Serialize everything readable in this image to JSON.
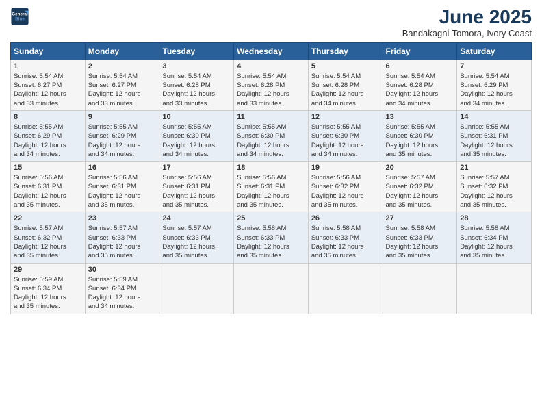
{
  "logo": {
    "line1": "General",
    "line2": "Blue"
  },
  "title": "June 2025",
  "subtitle": "Bandakagni-Tomora, Ivory Coast",
  "days_of_week": [
    "Sunday",
    "Monday",
    "Tuesday",
    "Wednesday",
    "Thursday",
    "Friday",
    "Saturday"
  ],
  "weeks": [
    [
      {
        "day": "1",
        "info": "Sunrise: 5:54 AM\nSunset: 6:27 PM\nDaylight: 12 hours\nand 33 minutes."
      },
      {
        "day": "2",
        "info": "Sunrise: 5:54 AM\nSunset: 6:27 PM\nDaylight: 12 hours\nand 33 minutes."
      },
      {
        "day": "3",
        "info": "Sunrise: 5:54 AM\nSunset: 6:28 PM\nDaylight: 12 hours\nand 33 minutes."
      },
      {
        "day": "4",
        "info": "Sunrise: 5:54 AM\nSunset: 6:28 PM\nDaylight: 12 hours\nand 33 minutes."
      },
      {
        "day": "5",
        "info": "Sunrise: 5:54 AM\nSunset: 6:28 PM\nDaylight: 12 hours\nand 34 minutes."
      },
      {
        "day": "6",
        "info": "Sunrise: 5:54 AM\nSunset: 6:28 PM\nDaylight: 12 hours\nand 34 minutes."
      },
      {
        "day": "7",
        "info": "Sunrise: 5:54 AM\nSunset: 6:29 PM\nDaylight: 12 hours\nand 34 minutes."
      }
    ],
    [
      {
        "day": "8",
        "info": "Sunrise: 5:55 AM\nSunset: 6:29 PM\nDaylight: 12 hours\nand 34 minutes."
      },
      {
        "day": "9",
        "info": "Sunrise: 5:55 AM\nSunset: 6:29 PM\nDaylight: 12 hours\nand 34 minutes."
      },
      {
        "day": "10",
        "info": "Sunrise: 5:55 AM\nSunset: 6:30 PM\nDaylight: 12 hours\nand 34 minutes."
      },
      {
        "day": "11",
        "info": "Sunrise: 5:55 AM\nSunset: 6:30 PM\nDaylight: 12 hours\nand 34 minutes."
      },
      {
        "day": "12",
        "info": "Sunrise: 5:55 AM\nSunset: 6:30 PM\nDaylight: 12 hours\nand 34 minutes."
      },
      {
        "day": "13",
        "info": "Sunrise: 5:55 AM\nSunset: 6:30 PM\nDaylight: 12 hours\nand 35 minutes."
      },
      {
        "day": "14",
        "info": "Sunrise: 5:55 AM\nSunset: 6:31 PM\nDaylight: 12 hours\nand 35 minutes."
      }
    ],
    [
      {
        "day": "15",
        "info": "Sunrise: 5:56 AM\nSunset: 6:31 PM\nDaylight: 12 hours\nand 35 minutes."
      },
      {
        "day": "16",
        "info": "Sunrise: 5:56 AM\nSunset: 6:31 PM\nDaylight: 12 hours\nand 35 minutes."
      },
      {
        "day": "17",
        "info": "Sunrise: 5:56 AM\nSunset: 6:31 PM\nDaylight: 12 hours\nand 35 minutes."
      },
      {
        "day": "18",
        "info": "Sunrise: 5:56 AM\nSunset: 6:31 PM\nDaylight: 12 hours\nand 35 minutes."
      },
      {
        "day": "19",
        "info": "Sunrise: 5:56 AM\nSunset: 6:32 PM\nDaylight: 12 hours\nand 35 minutes."
      },
      {
        "day": "20",
        "info": "Sunrise: 5:57 AM\nSunset: 6:32 PM\nDaylight: 12 hours\nand 35 minutes."
      },
      {
        "day": "21",
        "info": "Sunrise: 5:57 AM\nSunset: 6:32 PM\nDaylight: 12 hours\nand 35 minutes."
      }
    ],
    [
      {
        "day": "22",
        "info": "Sunrise: 5:57 AM\nSunset: 6:32 PM\nDaylight: 12 hours\nand 35 minutes."
      },
      {
        "day": "23",
        "info": "Sunrise: 5:57 AM\nSunset: 6:33 PM\nDaylight: 12 hours\nand 35 minutes."
      },
      {
        "day": "24",
        "info": "Sunrise: 5:57 AM\nSunset: 6:33 PM\nDaylight: 12 hours\nand 35 minutes."
      },
      {
        "day": "25",
        "info": "Sunrise: 5:58 AM\nSunset: 6:33 PM\nDaylight: 12 hours\nand 35 minutes."
      },
      {
        "day": "26",
        "info": "Sunrise: 5:58 AM\nSunset: 6:33 PM\nDaylight: 12 hours\nand 35 minutes."
      },
      {
        "day": "27",
        "info": "Sunrise: 5:58 AM\nSunset: 6:33 PM\nDaylight: 12 hours\nand 35 minutes."
      },
      {
        "day": "28",
        "info": "Sunrise: 5:58 AM\nSunset: 6:34 PM\nDaylight: 12 hours\nand 35 minutes."
      }
    ],
    [
      {
        "day": "29",
        "info": "Sunrise: 5:59 AM\nSunset: 6:34 PM\nDaylight: 12 hours\nand 35 minutes."
      },
      {
        "day": "30",
        "info": "Sunrise: 5:59 AM\nSunset: 6:34 PM\nDaylight: 12 hours\nand 34 minutes."
      },
      {
        "day": "",
        "info": ""
      },
      {
        "day": "",
        "info": ""
      },
      {
        "day": "",
        "info": ""
      },
      {
        "day": "",
        "info": ""
      },
      {
        "day": "",
        "info": ""
      }
    ]
  ]
}
